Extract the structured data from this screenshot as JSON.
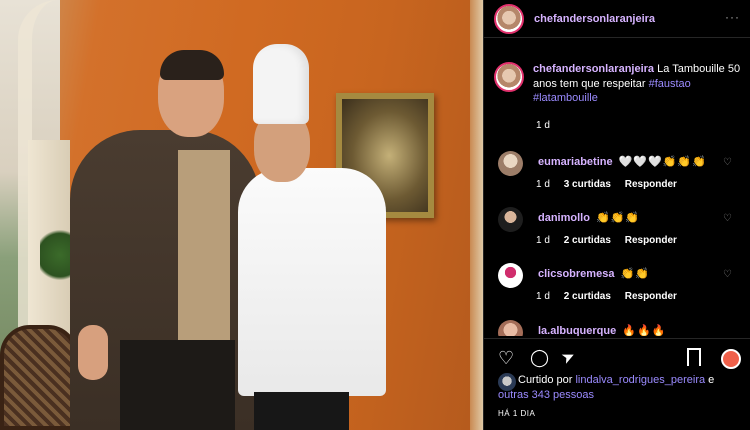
{
  "post": {
    "username": "chefandersonlaranjeira",
    "caption_user": "chefandersonlaranjeira",
    "caption_text": " La Tambouille 50 anos tem que respeitar ",
    "hashtag1": "#faustao",
    "hashtag2": "#latambouille",
    "caption_time": "1 d",
    "more_icon": "···"
  },
  "comments": [
    {
      "user": "eumariabetine",
      "text": "🤍🤍🤍👏👏👏",
      "time": "1 d",
      "likes": "3 curtidas",
      "reply": "Responder",
      "avatar_color": "#c9b7a3"
    },
    {
      "user": "danimollo",
      "text": "👏👏👏",
      "time": "1 d",
      "likes": "2 curtidas",
      "reply": "Responder",
      "avatar_color": "#3a3a3a"
    },
    {
      "user": "clicsobremesa",
      "text": "👏👏",
      "time": "1 d",
      "likes": "2 curtidas",
      "reply": "Responder",
      "avatar_color": "#ffffff"
    },
    {
      "user": "la.albuquerque",
      "text": "🔥🔥🔥",
      "time": "",
      "likes": "",
      "reply": "",
      "avatar_color": "#d8a08a"
    }
  ],
  "likes": {
    "prefix": "Curtido por ",
    "user": "lindalva_rodrigues_pereira",
    "mid": " e ",
    "others": "outras 343 pessoas"
  },
  "time_ago": "HÁ 1 DIA",
  "icons": {
    "heart": "♡",
    "comment": "◯",
    "share": "➤",
    "comment_like": "♡"
  }
}
